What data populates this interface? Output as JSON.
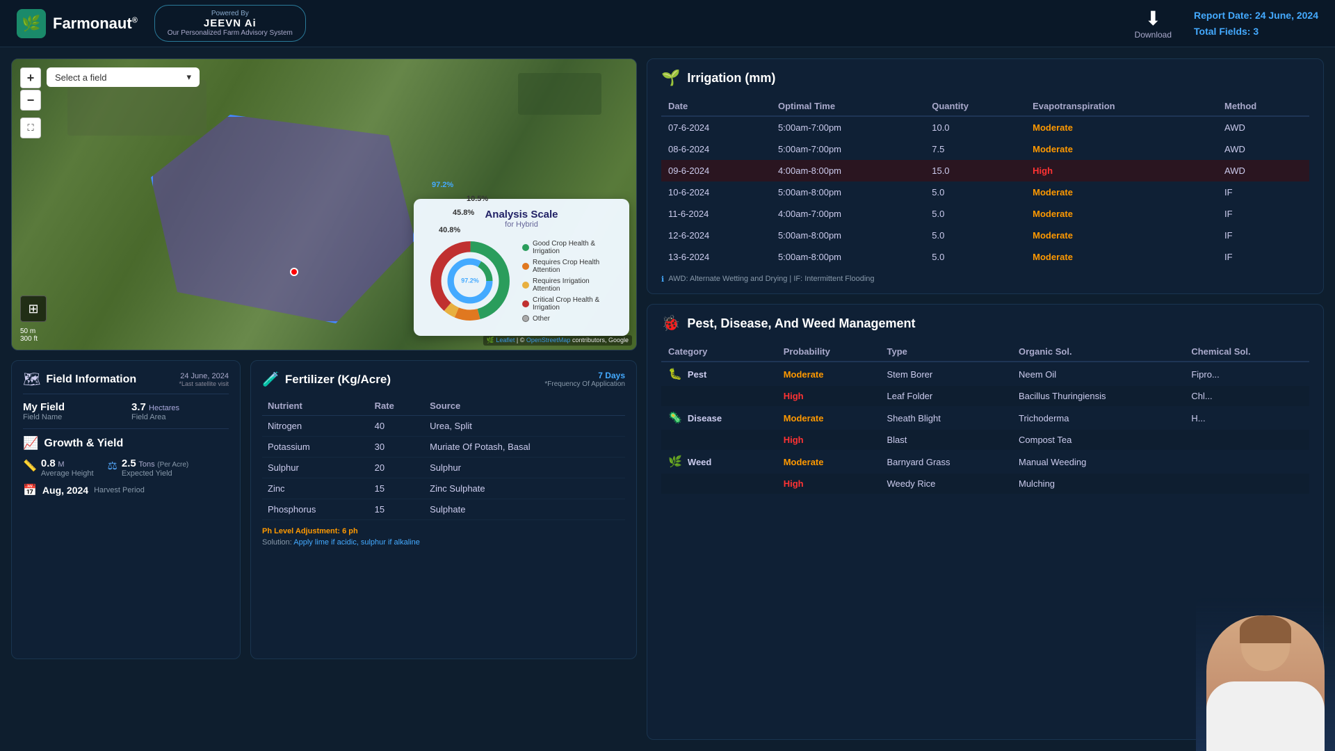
{
  "header": {
    "logo_text": "Farmonaut",
    "logo_sup": "®",
    "jeevn_powered_by": "Powered By",
    "jeevn_name": "JEEVN Ai",
    "jeevn_subtitle": "Our Personalized Farm Advisory System",
    "report_label": "Report Date:",
    "report_date": "24 June, 2024",
    "total_fields_label": "Total Fields:",
    "total_fields": "3",
    "download_label": "Download"
  },
  "map": {
    "field_select_placeholder": "Select a field",
    "zoom_in": "+",
    "zoom_out": "−",
    "scale_m": "50 m",
    "scale_ft": "300 ft",
    "attribution": "Leaflet | © OpenStreetMap contributors, Google"
  },
  "analysis_scale": {
    "title": "Analysis Scale",
    "subtitle": "for Hybrid",
    "segments": [
      {
        "label": "Good Crop Health & Irrigation",
        "color": "#2a9d5c",
        "percent": 45.8,
        "display": "45.8%"
      },
      {
        "label": "Requires Crop Health Attention",
        "color": "#e07820",
        "percent": 10.5,
        "display": "10.5%"
      },
      {
        "label": "Requires Irrigation Attention",
        "color": "#e04050",
        "percent": 5,
        "display": "5%"
      },
      {
        "label": "Critical Crop Health & Irrigation",
        "color": "#c03030",
        "percent": 97.2,
        "display": "97.2%"
      },
      {
        "label": "Other",
        "color": "#ccc",
        "percent": 40.8,
        "display": "40.8%"
      }
    ],
    "center_label_1": "97.2%",
    "center_label_2": "10.5%",
    "center_label_3": "45.8%",
    "center_label_4": "40.8%"
  },
  "field_info": {
    "title": "Field Information",
    "date": "24 June, 2024",
    "date_sub": "*Last satellite visit",
    "field_name_label": "Field Name",
    "field_name": "My Field",
    "field_area_label": "Field Area",
    "field_area": "3.7",
    "field_area_unit": "Hectares"
  },
  "growth": {
    "title": "Growth & Yield",
    "height_val": "0.8",
    "height_unit": "M",
    "height_label": "Average Height",
    "yield_val": "2.5",
    "yield_unit": "Tons",
    "yield_sub": "(Per Acre)",
    "yield_label": "Expected Yield",
    "harvest_month": "Aug, 2024",
    "harvest_label": "Harvest Period"
  },
  "fertilizer": {
    "title": "Fertilizer (Kg/Acre)",
    "frequency": "7 Days",
    "frequency_sub": "*Frequency Of Application",
    "col_nutrient": "Nutrient",
    "col_rate": "Rate",
    "col_source": "Source",
    "rows": [
      {
        "nutrient": "Nitrogen",
        "rate": "40",
        "source": "Urea, Split"
      },
      {
        "nutrient": "Potassium",
        "rate": "30",
        "source": "Muriate Of Potash, Basal"
      },
      {
        "nutrient": "Sulphur",
        "rate": "20",
        "source": "Sulphur"
      },
      {
        "nutrient": "Zinc",
        "rate": "15",
        "source": "Zinc Sulphate"
      },
      {
        "nutrient": "Phosphorus",
        "rate": "15",
        "source": "Sulphate"
      }
    ],
    "ph_note": "Ph Level Adjustment:",
    "ph_value": "6 ph",
    "solution_label": "Solution:",
    "solution_text": "Apply lime if acidic, sulphur if alkaline"
  },
  "irrigation": {
    "title": "Irrigation (mm)",
    "col_date": "Date",
    "col_optimal": "Optimal Time",
    "col_qty": "Quantity",
    "col_evap": "Evapotranspiration",
    "col_method": "Method",
    "rows": [
      {
        "date": "07-6-2024",
        "optimal": "5:00am-7:00pm",
        "qty": "10.0",
        "evap": "Moderate",
        "method": "AWD",
        "highlight": false
      },
      {
        "date": "08-6-2024",
        "optimal": "5:00am-7:00pm",
        "qty": "7.5",
        "evap": "Moderate",
        "method": "AWD",
        "highlight": false
      },
      {
        "date": "09-6-2024",
        "optimal": "4:00am-8:00pm",
        "qty": "15.0",
        "evap": "High",
        "method": "AWD",
        "highlight": true
      },
      {
        "date": "10-6-2024",
        "optimal": "5:00am-8:00pm",
        "qty": "5.0",
        "evap": "Moderate",
        "method": "IF",
        "highlight": false
      },
      {
        "date": "11-6-2024",
        "optimal": "4:00am-7:00pm",
        "qty": "5.0",
        "evap": "Moderate",
        "method": "IF",
        "highlight": false
      },
      {
        "date": "12-6-2024",
        "optimal": "5:00am-8:00pm",
        "qty": "5.0",
        "evap": "Moderate",
        "method": "IF",
        "highlight": false
      },
      {
        "date": "13-6-2024",
        "optimal": "5:00am-8:00pm",
        "qty": "5.0",
        "evap": "Moderate",
        "method": "IF",
        "highlight": false
      }
    ],
    "note": "AWD: Alternate Wetting and Drying | IF: Intermittent Flooding"
  },
  "pest": {
    "title": "Pest, Disease, And Weed Management",
    "col_category": "Category",
    "col_probability": "Probability",
    "col_type": "Type",
    "col_organic": "Organic Sol.",
    "col_chemical": "Chemical Sol.",
    "rows": [
      {
        "category": "Pest",
        "category_icon": "🐛",
        "probability": "Moderate",
        "type": "Stem Borer",
        "organic": "Neem Oil",
        "chemical": "Fipro...",
        "highlight": false
      },
      {
        "category": "",
        "category_icon": "",
        "probability": "High",
        "type": "Leaf Folder",
        "organic": "Bacillus Thuringiensis",
        "chemical": "Chl...",
        "highlight": true
      },
      {
        "category": "Disease",
        "category_icon": "🦠",
        "probability": "Moderate",
        "type": "Sheath Blight",
        "organic": "Trichoderma",
        "chemical": "H...",
        "highlight": false
      },
      {
        "category": "",
        "category_icon": "",
        "probability": "High",
        "type": "Blast",
        "organic": "Compost Tea",
        "chemical": "",
        "highlight": true
      },
      {
        "category": "Weed",
        "category_icon": "🌿",
        "probability": "Moderate",
        "type": "Barnyard Grass",
        "organic": "Manual Weeding",
        "chemical": "",
        "highlight": false
      },
      {
        "category": "",
        "category_icon": "",
        "probability": "High",
        "type": "Weedy Rice",
        "organic": "Mulching",
        "chemical": "",
        "highlight": true
      }
    ]
  }
}
